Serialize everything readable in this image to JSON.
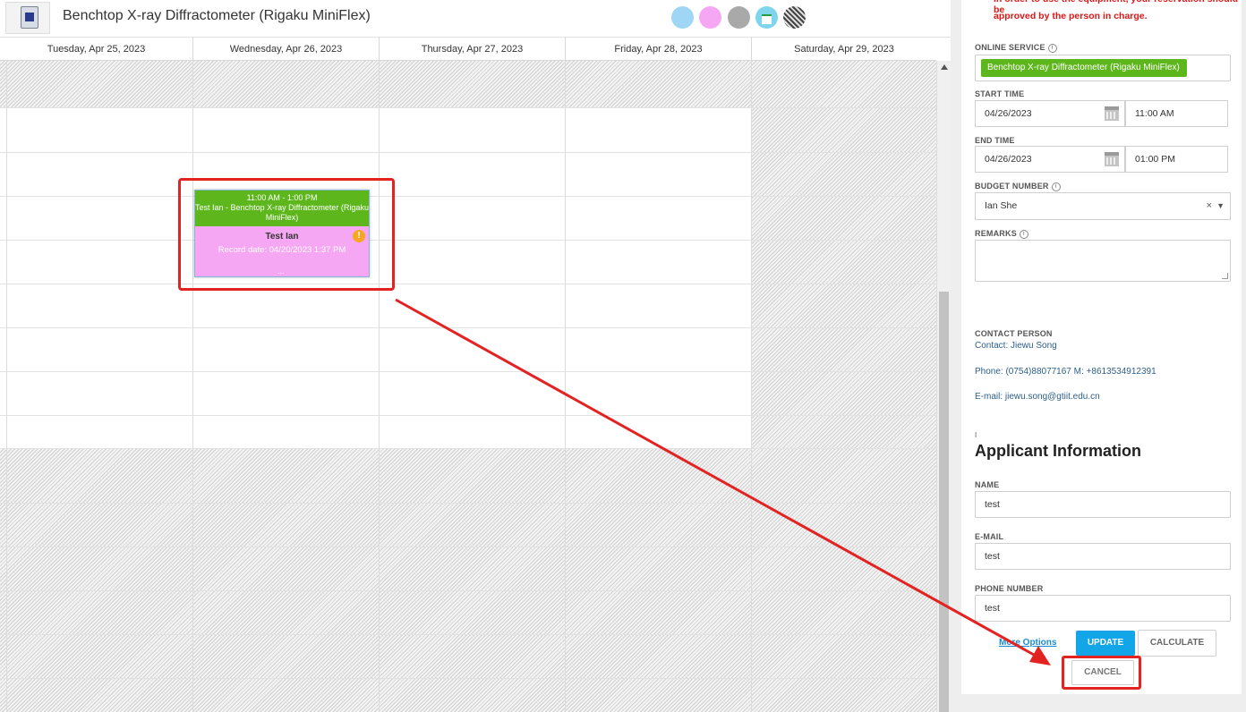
{
  "header": {
    "title": "Benchtop X-ray Diffractometer (Rigaku MiniFlex)"
  },
  "calendar": {
    "days": [
      "Tuesday, Apr 25, 2023",
      "Wednesday, Apr 26, 2023",
      "Thursday, Apr 27, 2023",
      "Friday, Apr 28, 2023",
      "Saturday, Apr 29, 2023"
    ],
    "event": {
      "time": "11:00 AM - 1:00 PM",
      "title": "Test Ian - Benchtop X-ray Diffractometer (Rigaku MiniFlex)",
      "name": "Test Ian",
      "record": "Record date: 04/20/2023 1:37 PM",
      "warning": "!",
      "dots": "..."
    }
  },
  "colors": {
    "event_top": "#5db61b",
    "event_bottom": "#f6a7f3",
    "annotation": "#e32222",
    "update_button": "#12a5e8",
    "notice": "#e01515"
  },
  "icons": {
    "equipment": "equipment-thumbnail-icon",
    "legend": [
      "legend-blue-dot-icon",
      "legend-pink-dot-icon",
      "legend-gray-dot-icon",
      "legend-calendar-icon",
      "legend-hatched-icon"
    ],
    "warning": "warning-icon",
    "calendar": "calendar-icon",
    "info": "info-icon"
  },
  "form": {
    "notice_line1": "In order to use the equipment, your reservation should be",
    "notice_line2": "approved by the person in charge.",
    "online_service_label": "ONLINE SERVICE",
    "online_service_value": "Benchtop X-ray Diffractometer (Rigaku MiniFlex)",
    "start_time_label": "START TIME",
    "start_date": "04/26/2023",
    "start_time": "11:00 AM",
    "end_time_label": "END TIME",
    "end_date": "04/26/2023",
    "end_time": "01:00 PM",
    "budget_label": "BUDGET NUMBER",
    "budget_value": "Ian She",
    "budget_clear": "×",
    "budget_caret": "▼",
    "remarks_label": "REMARKS",
    "remarks_value": "",
    "info_glyph": "i",
    "contact_label": "CONTACT PERSON",
    "contact_name": "Contact: Jiewu Song",
    "contact_phone": "Phone: (0754)88077167  M: +8613534912391",
    "contact_email": "E-mail: jiewu.song@gtiit.edu.cn",
    "section_mark": "I",
    "applicant_title": "Applicant Information",
    "name_label": "NAME",
    "name_value": "test",
    "email_label": "E-MAIL",
    "email_value": "test",
    "phone_label": "PHONE NUMBER",
    "phone_value": "test",
    "more_options": "More Options",
    "update": "UPDATE",
    "calculate": "CALCULATE",
    "cancel": "CANCEL"
  }
}
